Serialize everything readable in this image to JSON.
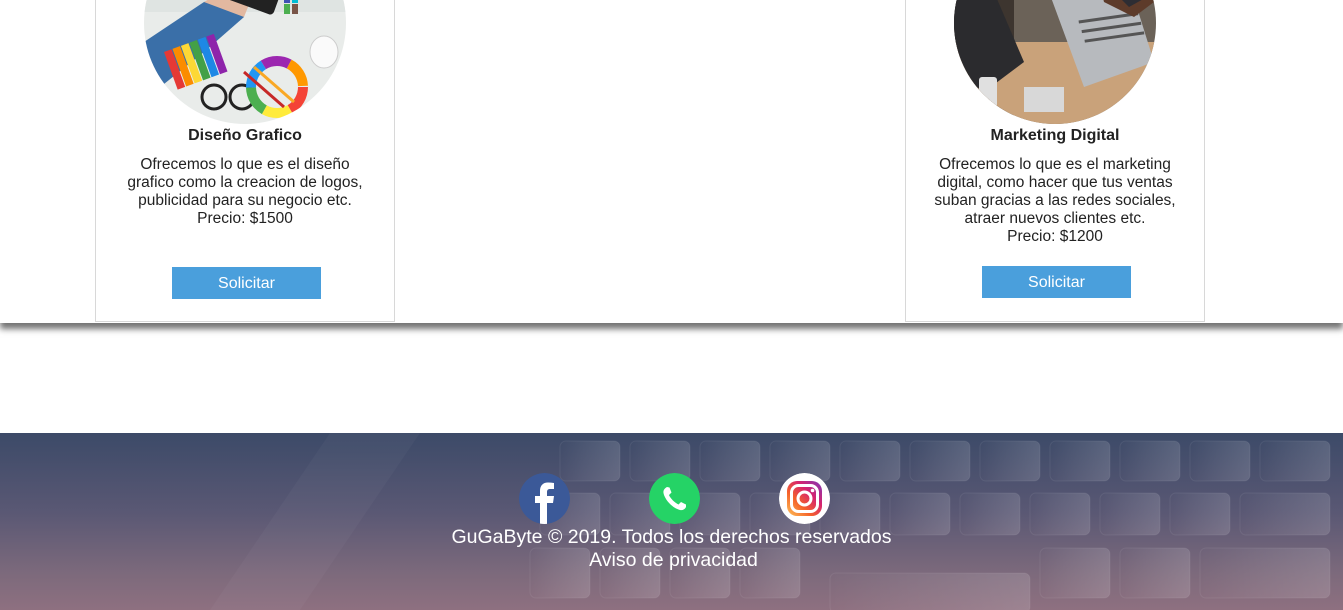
{
  "services": [
    {
      "title": "Diseño Grafico",
      "description": "Ofrecemos lo que es el diseño grafico como la creacion de logos, publicidad para su negocio etc.",
      "price": "Precio: $1500",
      "button": "Solicitar",
      "image_icon": "graphic-design-photo"
    },
    {
      "title": "Marketing Digital",
      "description": "Ofrecemos lo que es el marketing digital, como hacer que tus ventas suban gracias a las redes sociales, atraer nuevos clientes etc.",
      "price": "Precio: $1200",
      "button": "Solicitar",
      "image_icon": "laptop-photo"
    }
  ],
  "footer": {
    "social": [
      "facebook-icon",
      "whatsapp-icon",
      "instagram-icon"
    ],
    "copyright": "GuGaByte © 2019. Todos los derechos reservados",
    "privacy": "Aviso de privacidad"
  },
  "colors": {
    "button": "#4a9fdc",
    "facebook": "#3b5998",
    "whatsapp": "#25d366"
  }
}
